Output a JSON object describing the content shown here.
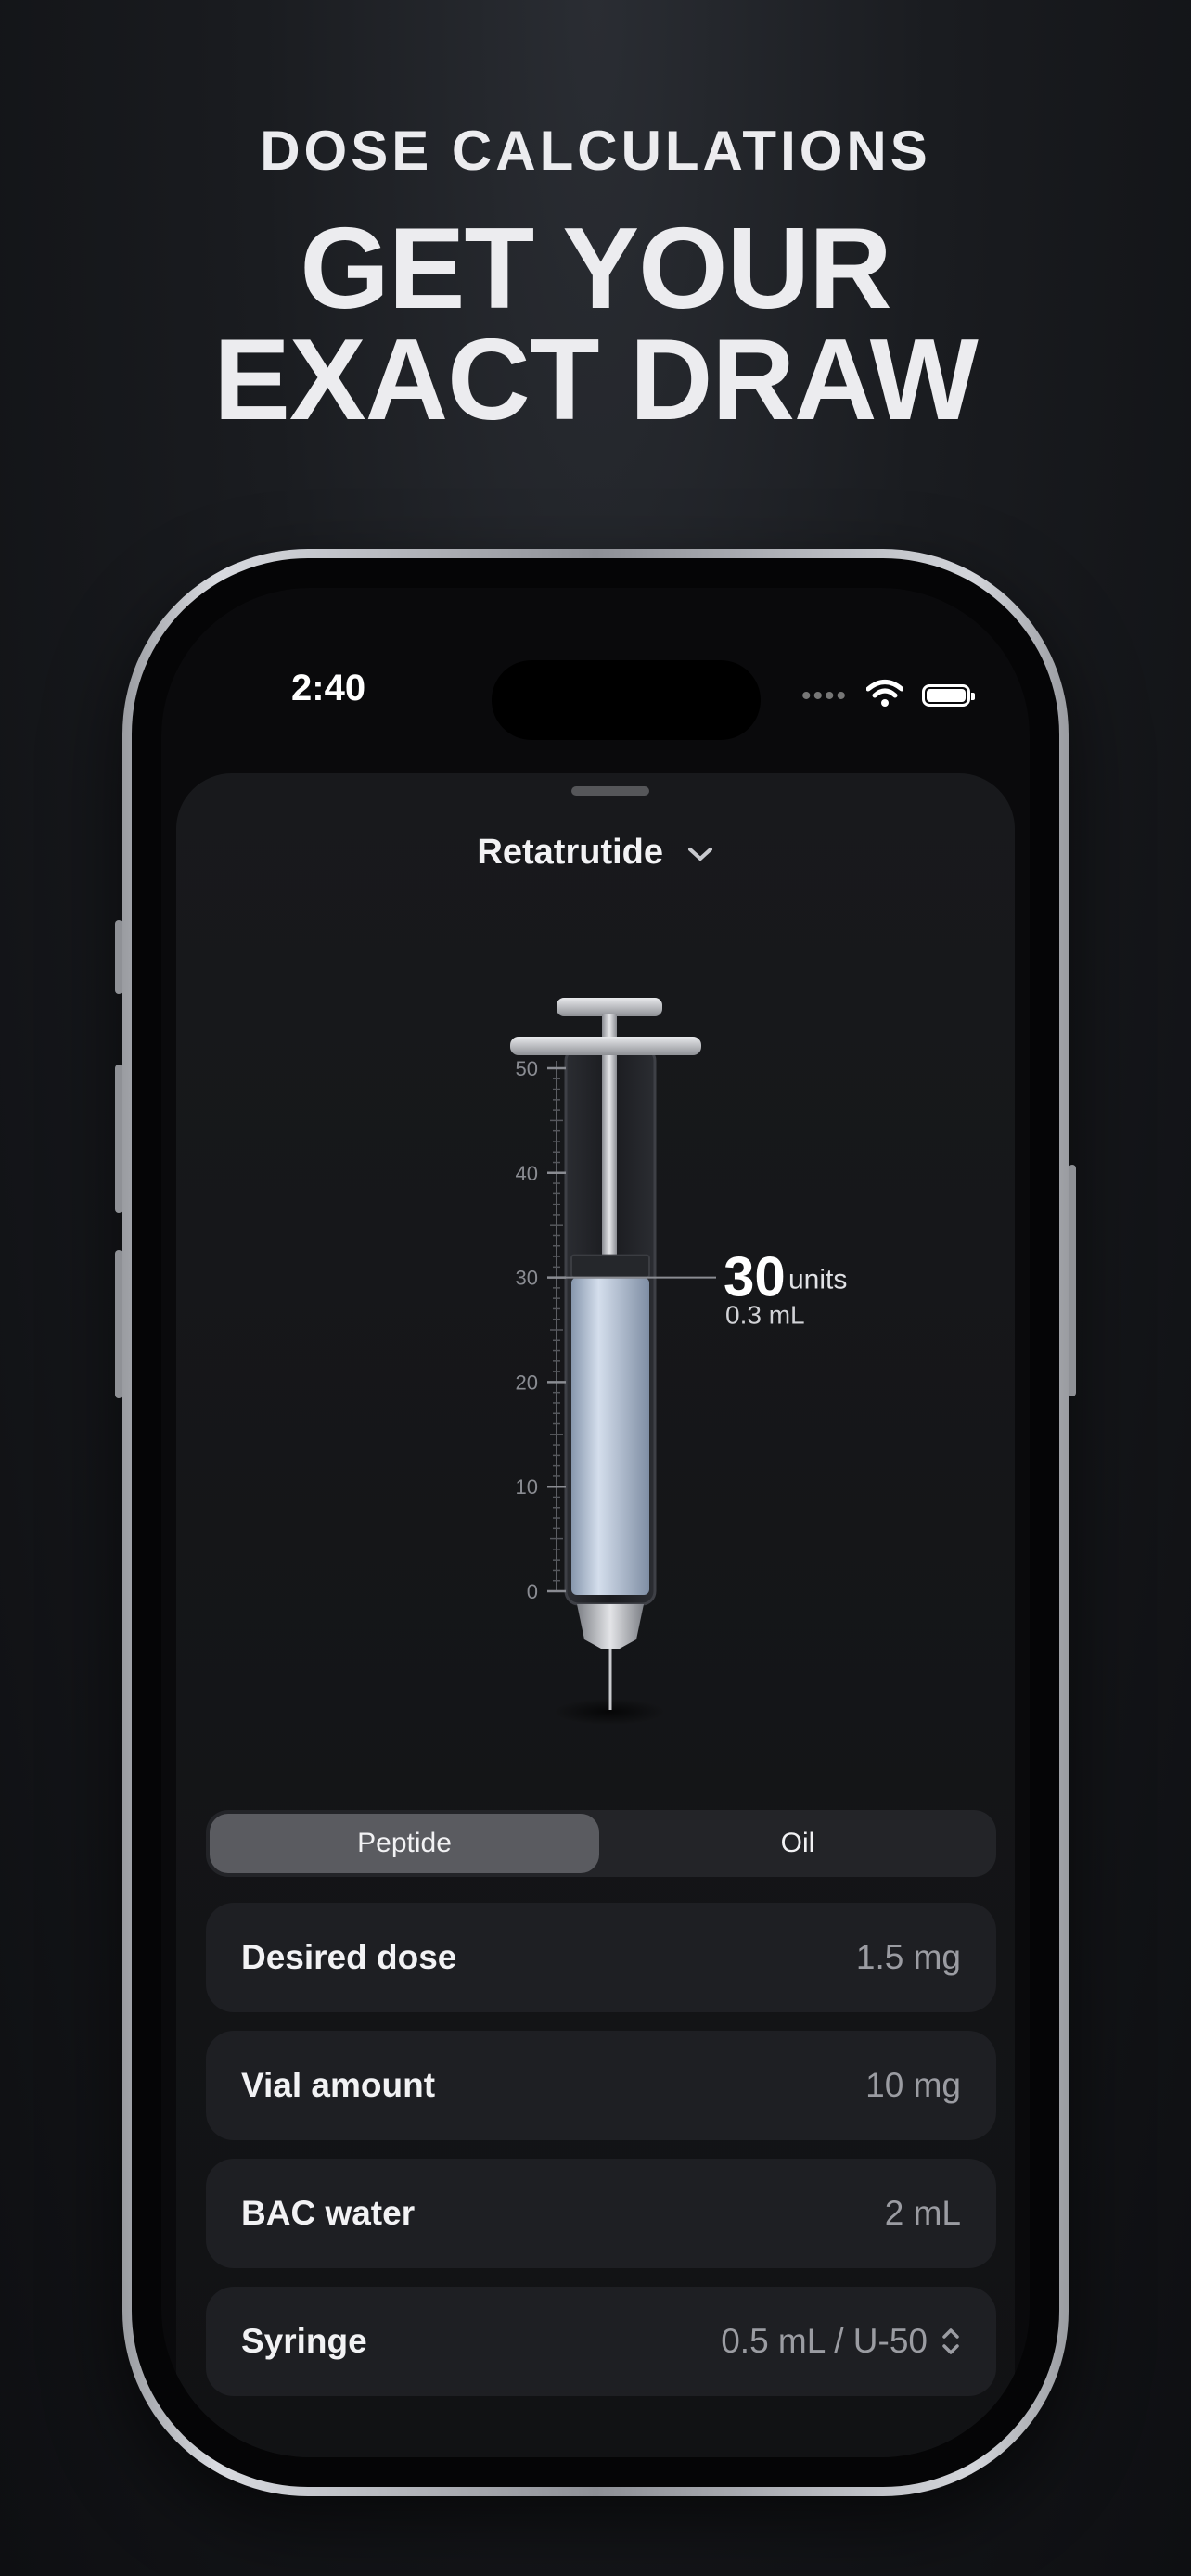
{
  "promo": {
    "eyebrow": "DOSE CALCULATIONS",
    "headline_line1": "GET YOUR",
    "headline_line2": "EXACT DRAW"
  },
  "status_bar": {
    "time": "2:40",
    "signal_dots": "••••"
  },
  "picker": {
    "selected": "Retatrutide"
  },
  "syringe": {
    "scale_labels": [
      "50",
      "40",
      "30",
      "20",
      "10",
      "0"
    ],
    "max_units": 50,
    "fill_units": 30,
    "readout_value": "30",
    "readout_unit": "units",
    "readout_ml": "0.3 mL"
  },
  "mode_toggle": {
    "options": [
      "Peptide",
      "Oil"
    ],
    "selected": "Peptide"
  },
  "fields": [
    {
      "label": "Desired dose",
      "value": "1.5 mg"
    },
    {
      "label": "Vial amount",
      "value": "10 mg"
    },
    {
      "label": "BAC water",
      "value": "2 mL"
    },
    {
      "label": "Syringe",
      "value": "0.5 mL / U-50"
    }
  ],
  "colors": {
    "background": "#111214",
    "liquid": "#b8c6da",
    "row_bg": "#1e1f23",
    "segment_active": "#5a5b60"
  }
}
